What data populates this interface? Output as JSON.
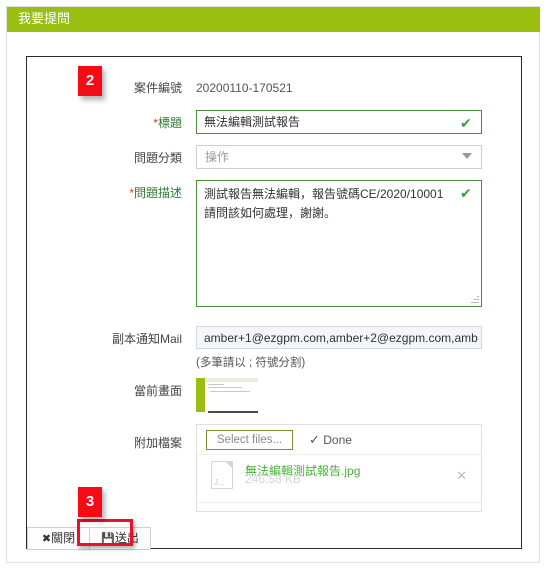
{
  "window": {
    "title": "我要提問"
  },
  "badges": [
    {
      "label": "2"
    },
    {
      "label": "3"
    }
  ],
  "form": {
    "case_no": {
      "label": "案件編號",
      "value": "20200110-170521"
    },
    "subject": {
      "label": "標題",
      "required_mark": "*",
      "value": "無法編輯測試報告",
      "valid_icon": "✔"
    },
    "category": {
      "label": "問題分類",
      "value": "操作",
      "caret_icon": "chevron-down-icon"
    },
    "description": {
      "label": "問題描述",
      "required_mark": "*",
      "line1": "測試報告無法編輯，報告號碼CE/2020/10001",
      "line2": "請問該如何處理，謝謝。",
      "valid_icon": "✔"
    },
    "cc_mail": {
      "label": "副本通知Mail",
      "value": "amber+1@ezgpm.com,amber+2@ezgpm.com,amb",
      "hint": "(多筆請以 ; 符號分割)"
    },
    "current_screen": {
      "label": "當前畫面"
    },
    "attachment": {
      "label": "附加檔案",
      "select_button": "Select files...",
      "done_icon": "✓",
      "done_label": "Done",
      "files": [
        {
          "name": "無法編輯測試報告",
          "ext": ".jpg",
          "size": "246.58 KB",
          "icon_text": "J...",
          "remove_icon": "✕"
        }
      ]
    }
  },
  "footer": {
    "close_icon": "✖",
    "close_label": "關閉",
    "submit_icon": "💾",
    "submit_label": "送出"
  },
  "colors": {
    "header_green": "#9ABF10",
    "valid_green": "#4f8b3b",
    "badge_red": "#f40b16",
    "highlight_red": "#e8132b"
  }
}
